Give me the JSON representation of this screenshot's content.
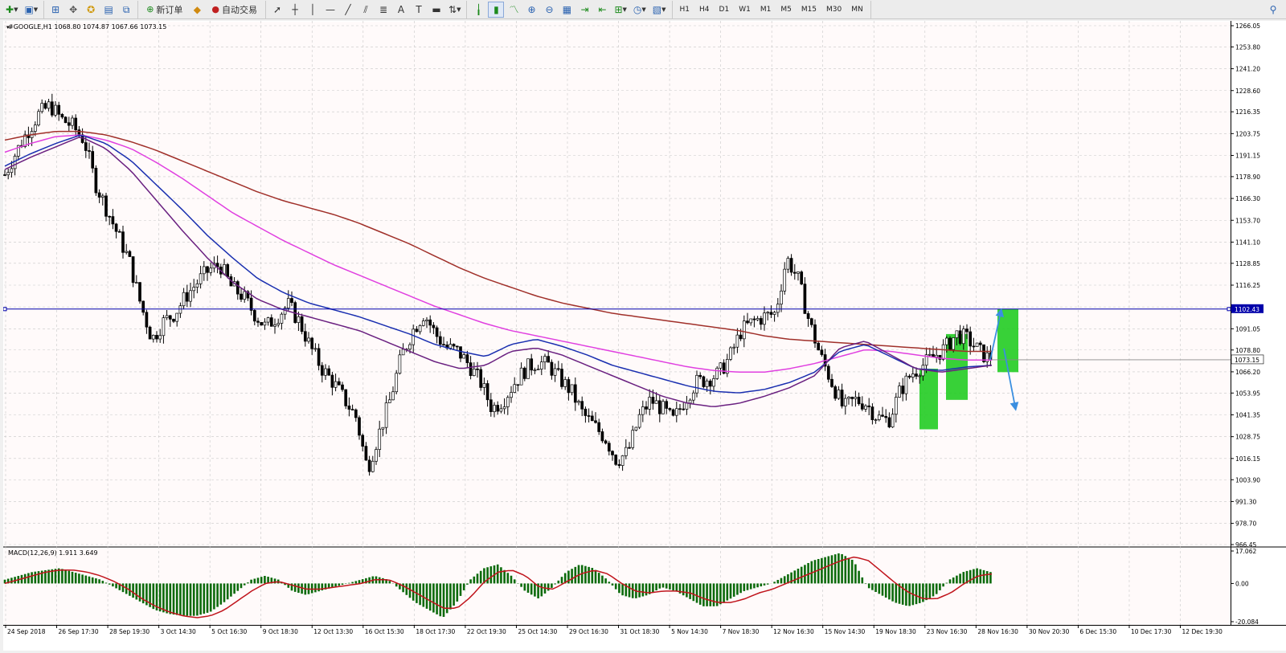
{
  "toolbar": {
    "new_order_label": "新订单",
    "auto_trading_label": "自动交易",
    "timeframes": [
      "H1",
      "H4",
      "D1",
      "W1",
      "M1",
      "M5",
      "M15",
      "M30",
      "MN"
    ],
    "icons": [
      "new-chart-icon",
      "profiles-icon",
      "market-watch-icon",
      "navigator-icon",
      "data-window-icon",
      "terminal-icon",
      "strategy-tester-icon",
      "cursor-icon",
      "crosshair-icon",
      "vertical-line-icon",
      "horizontal-line-icon",
      "trendline-icon",
      "channel-icon",
      "fibonacci-icon",
      "text-icon",
      "text-label-icon",
      "rectangle-icon",
      "arrows-icon",
      "bar-chart-icon",
      "candlestick-icon",
      "line-chart-icon",
      "zoom-in-icon",
      "zoom-out-icon",
      "tile-windows-icon",
      "autoscroll-icon",
      "chart-shift-icon",
      "indicators-icon",
      "periods-icon",
      "templates-icon",
      "search-icon"
    ]
  },
  "chart": {
    "title": "#GOOGLE,H1  1068.80 1074.87 1067.66 1073.15",
    "price_labels": [
      "1266.05",
      "1253.80",
      "1241.20",
      "1228.60",
      "1216.35",
      "1203.75",
      "1191.15",
      "1178.90",
      "1166.30",
      "1153.70",
      "1141.10",
      "1128.85",
      "1116.25",
      "1103.65",
      "1091.05",
      "1078.80",
      "1066.20",
      "1053.95",
      "1041.35",
      "1028.75",
      "1016.15",
      "1003.90",
      "991.30",
      "978.70",
      "966.45"
    ],
    "hline_value": "1102.43",
    "current_price": "1073.15",
    "date_labels": [
      "24 Sep 2018",
      "26 Sep 17:30",
      "28 Sep 19:30",
      "3 Oct 14:30",
      "5 Oct 16:30",
      "9 Oct 18:30",
      "12 Oct 13:30",
      "16 Oct 15:30",
      "18 Oct 17:30",
      "22 Oct 19:30",
      "25 Oct 14:30",
      "29 Oct 16:30",
      "31 Oct 18:30",
      "5 Nov 14:30",
      "7 Nov 18:30",
      "12 Nov 16:30",
      "15 Nov 14:30",
      "19 Nov 18:30",
      "23 Nov 16:30",
      "28 Nov 16:30",
      "30 Nov 20:30",
      "6 Dec 15:30",
      "10 Dec 17:30",
      "12 Dec 19:30"
    ],
    "colors": {
      "background": "#fffafa",
      "hline": "#0000aa",
      "ma1": "#a0302a",
      "ma2": "#e040e0",
      "ma3": "#1a2fb0",
      "ma4": "#6a2080",
      "macd_hist": "#0b6a0b",
      "macd_signal": "#c0141c",
      "highlight": "#22cc22",
      "arrow": "#3b8fe0"
    }
  },
  "macd": {
    "label": "MACD(12,26,9) 1.911 3.649",
    "scale_labels": [
      "17.062",
      "0.00",
      "-20.084"
    ]
  },
  "chart_data": {
    "type": "candlestick",
    "symbol": "#GOOGLE",
    "timeframe": "H1",
    "ohlc_last": {
      "open": 1068.8,
      "high": 1074.87,
      "low": 1067.66,
      "close": 1073.15
    },
    "ylim": [
      966.45,
      1266.05
    ],
    "horizontal_line": 1102.43,
    "x": [
      "24 Sep 2018",
      "26 Sep 17:30",
      "28 Sep 19:30",
      "3 Oct 14:30",
      "5 Oct 16:30",
      "9 Oct 18:30",
      "12 Oct 13:30",
      "16 Oct 15:30",
      "18 Oct 17:30",
      "22 Oct 19:30",
      "25 Oct 14:30",
      "29 Oct 16:30",
      "31 Oct 18:30",
      "5 Nov 14:30",
      "7 Nov 18:30",
      "12 Nov 16:30",
      "15 Nov 14:30",
      "19 Nov 18:30",
      "23 Nov 16:30",
      "28 Nov 16:30",
      "30 Nov 20:30",
      "6 Dec 15:30",
      "10 Dec 17:30",
      "12 Dec 19:30"
    ],
    "price_path": [
      1180,
      1193,
      1205,
      1215,
      1220,
      1212,
      1208,
      1200,
      1175,
      1160,
      1145,
      1130,
      1105,
      1085,
      1095,
      1100,
      1110,
      1118,
      1125,
      1128,
      1115,
      1110,
      1100,
      1092,
      1098,
      1105,
      1095,
      1080,
      1068,
      1060,
      1050,
      1040,
      1010,
      1030,
      1050,
      1075,
      1090,
      1100,
      1088,
      1080,
      1078,
      1070,
      1060,
      1045,
      1050,
      1060,
      1068,
      1072,
      1070,
      1062,
      1055,
      1042,
      1035,
      1028,
      1015,
      1020,
      1040,
      1050,
      1045,
      1038,
      1050,
      1060,
      1062,
      1065,
      1075,
      1090,
      1095,
      1098,
      1100,
      1132,
      1120,
      1095,
      1075,
      1060,
      1045,
      1050,
      1048,
      1040,
      1038,
      1055,
      1065,
      1070,
      1075,
      1080,
      1088,
      1085,
      1078,
      1073
    ],
    "ma_paths": {
      "ma1": [
        1200,
        1203,
        1205,
        1205,
        1203,
        1199,
        1194,
        1188,
        1182,
        1176,
        1170,
        1165,
        1161,
        1157,
        1152,
        1146,
        1140,
        1133,
        1126,
        1120,
        1115,
        1110,
        1106,
        1103,
        1100,
        1098,
        1096,
        1094,
        1092,
        1090,
        1087,
        1085,
        1084,
        1083,
        1082,
        1081,
        1080,
        1079,
        1078,
        1078
      ],
      "ma2": [
        1193,
        1198,
        1202,
        1203,
        1200,
        1195,
        1187,
        1178,
        1168,
        1158,
        1150,
        1142,
        1135,
        1128,
        1122,
        1116,
        1110,
        1104,
        1099,
        1094,
        1090,
        1087,
        1084,
        1081,
        1078,
        1075,
        1072,
        1069,
        1067,
        1066,
        1066,
        1068,
        1071,
        1075,
        1079,
        1078,
        1076,
        1074,
        1073,
        1073
      ],
      "ma3": [
        1185,
        1192,
        1198,
        1203,
        1198,
        1188,
        1174,
        1160,
        1145,
        1132,
        1120,
        1112,
        1106,
        1102,
        1098,
        1093,
        1088,
        1082,
        1078,
        1075,
        1082,
        1085,
        1081,
        1076,
        1070,
        1066,
        1062,
        1058,
        1055,
        1054,
        1056,
        1060,
        1066,
        1078,
        1082,
        1075,
        1068,
        1067,
        1069,
        1070
      ],
      "ma4": [
        1183,
        1190,
        1196,
        1202,
        1195,
        1182,
        1165,
        1148,
        1132,
        1118,
        1108,
        1102,
        1098,
        1094,
        1090,
        1084,
        1078,
        1072,
        1068,
        1070,
        1078,
        1080,
        1076,
        1070,
        1064,
        1058,
        1052,
        1048,
        1046,
        1048,
        1052,
        1057,
        1064,
        1080,
        1084,
        1076,
        1068,
        1066,
        1068,
        1070
      ]
    },
    "macd_range": [
      -20.084,
      17.062
    ],
    "macd_hist_path": [
      2,
      4,
      6,
      7,
      8,
      6,
      4,
      2,
      -2,
      -6,
      -10,
      -14,
      -16,
      -17,
      -17,
      -15,
      -10,
      -4,
      2,
      4,
      2,
      -4,
      -6,
      -4,
      -2,
      0,
      2,
      4,
      2,
      -4,
      -10,
      -14,
      -18,
      -10,
      2,
      8,
      10,
      4,
      -4,
      -8,
      -2,
      6,
      10,
      8,
      2,
      -6,
      -8,
      -6,
      -2,
      -4,
      -8,
      -12,
      -12,
      -8,
      -4,
      -2,
      0,
      4,
      8,
      12,
      14,
      16,
      12,
      -2,
      -6,
      -10,
      -12,
      -10,
      -6,
      2,
      6,
      8,
      6
    ],
    "macd_signal_path": [
      0,
      2,
      4,
      6,
      7,
      7,
      6,
      4,
      1,
      -3,
      -8,
      -12,
      -15,
      -17,
      -18,
      -17,
      -14,
      -9,
      -4,
      0,
      1,
      -1,
      -3,
      -3,
      -2,
      -1,
      0,
      2,
      2,
      -1,
      -5,
      -9,
      -13,
      -13,
      -7,
      1,
      6,
      7,
      4,
      -2,
      -3,
      1,
      5,
      7,
      5,
      0,
      -4,
      -5,
      -4,
      -4,
      -5,
      -8,
      -10,
      -10,
      -8,
      -5,
      -3,
      0,
      3,
      6,
      9,
      12,
      14,
      12,
      6,
      0,
      -5,
      -8,
      -8,
      -5,
      0,
      4,
      5
    ],
    "annotations": [
      {
        "type": "rectangle",
        "color": "green",
        "price_from": 1033,
        "price_to": 1068,
        "x_label": "6 Dec 15:30"
      },
      {
        "type": "rectangle",
        "color": "green",
        "price_from": 1050,
        "price_to": 1088,
        "x_label": "10 Dec 17:30"
      },
      {
        "type": "rectangle",
        "color": "green",
        "price_from": 1066,
        "price_to": 1102.43,
        "x_label": "12 Dec 19:30"
      }
    ]
  }
}
